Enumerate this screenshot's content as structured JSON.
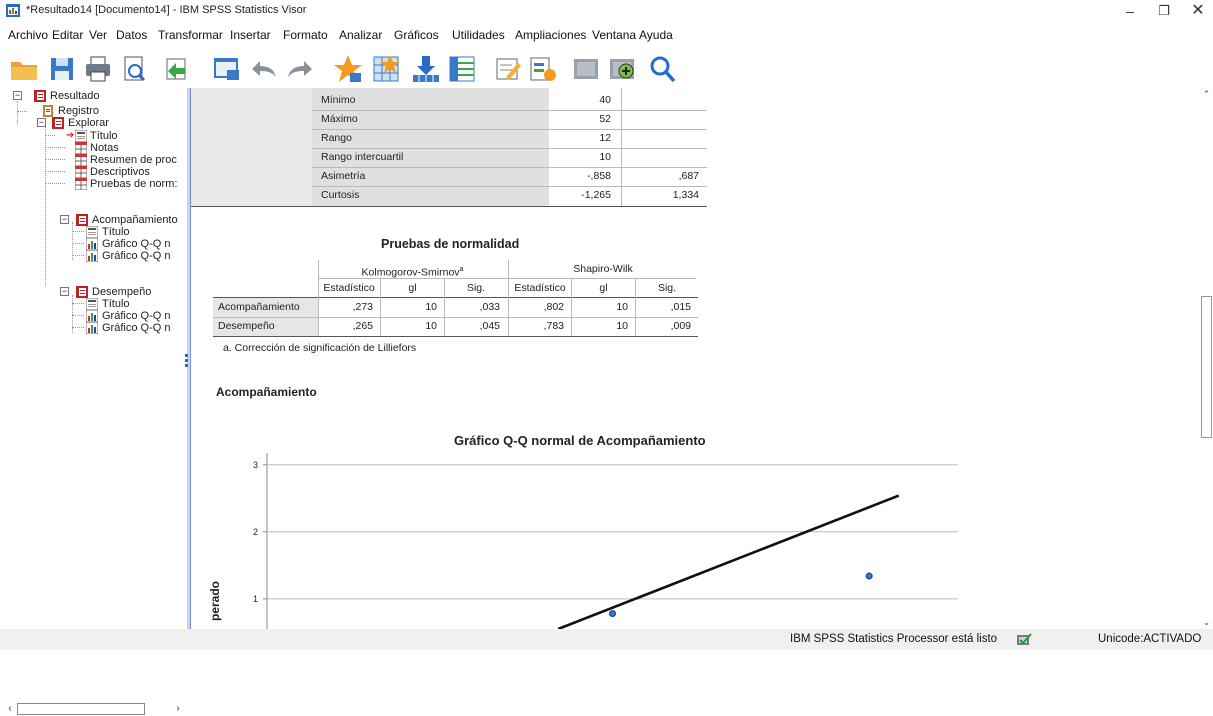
{
  "window": {
    "title": "*Resultado14 [Documento14] - IBM SPSS Statistics Visor",
    "minimize": "–",
    "maximize": "❐",
    "close": "✕"
  },
  "menu": [
    "Archivo",
    "Editar",
    "Ver",
    "Datos",
    "Transformar",
    "Insertar",
    "Formato",
    "Analizar",
    "Gráficos",
    "Utilidades",
    "Ampliaciones",
    "Ventana",
    "Ayuda"
  ],
  "toolbar": {
    "icons": [
      "open-folder-icon",
      "save-icon",
      "print-icon",
      "print-preview-icon",
      "export-icon",
      "recall-dialog-icon",
      "undo-icon",
      "redo-icon",
      "goto-data-icon",
      "goto-case-icon",
      "goto-variable-icon",
      "variables-icon",
      "designate-window-icon",
      "create-script-icon",
      "hide-icon",
      "show-icon",
      "search-icon"
    ]
  },
  "outline": {
    "items": [
      {
        "label": "Resultado",
        "icon": "output-book-icon"
      },
      {
        "label": "Registro",
        "icon": "log-icon"
      },
      {
        "label": "Explorar",
        "icon": "output-book-icon"
      },
      {
        "label": "Título",
        "icon": "title-icon"
      },
      {
        "label": "Notas",
        "icon": "notes-icon"
      },
      {
        "label": "Resumen de proc",
        "icon": "table-icon"
      },
      {
        "label": "Descriptivos",
        "icon": "table-icon"
      },
      {
        "label": "Pruebas de norm:",
        "icon": "table-icon"
      },
      {
        "label": "Acompañamiento",
        "icon": "output-book-icon"
      },
      {
        "label": "Título",
        "icon": "title-icon"
      },
      {
        "label": "Gráfico Q-Q n",
        "icon": "chart-icon"
      },
      {
        "label": "Gráfico Q-Q n",
        "icon": "chart-icon"
      },
      {
        "label": "Desempeño",
        "icon": "output-book-icon"
      },
      {
        "label": "Título",
        "icon": "title-icon"
      },
      {
        "label": "Gráfico Q-Q n",
        "icon": "chart-icon"
      },
      {
        "label": "Gráfico Q-Q n",
        "icon": "chart-icon"
      }
    ]
  },
  "descriptives": {
    "rows": [
      {
        "label": "Mínimo",
        "stat": "40",
        "err": ""
      },
      {
        "label": "Máximo",
        "stat": "52",
        "err": ""
      },
      {
        "label": "Rango",
        "stat": "12",
        "err": ""
      },
      {
        "label": "Rango intercuartil",
        "stat": "10",
        "err": ""
      },
      {
        "label": "Asimetría",
        "stat": "-,858",
        "err": ",687"
      },
      {
        "label": "Curtosis",
        "stat": "-1,265",
        "err": "1,334"
      }
    ]
  },
  "normality": {
    "title": "Pruebas de normalidad",
    "group1": "Kolmogorov-Smirnov",
    "group1_sup": "a",
    "group2": "Shapiro-Wilk",
    "columns": [
      "Estadístico",
      "gl",
      "Sig.",
      "Estadístico",
      "gl",
      "Sig."
    ],
    "rows": [
      {
        "label": "Acompañamiento",
        "values": [
          ",273",
          "10",
          ",033",
          ",802",
          "10",
          ",015"
        ]
      },
      {
        "label": "Desempeño",
        "values": [
          ",265",
          "10",
          ",045",
          ",783",
          "10",
          ",009"
        ]
      }
    ],
    "footnote": "a. Corrección de significación de Lilliefors"
  },
  "section_heading": "Acompañamiento",
  "chart_data": {
    "type": "scatter",
    "title": "Gráfico Q-Q normal de Acompañamiento",
    "ylabel": "Normal esperado",
    "ylabel_visible": "perado",
    "yticks": [
      1,
      2,
      3
    ],
    "ylim": [
      0.55,
      3.25
    ],
    "xlim": [
      39,
      53
    ],
    "points": [
      {
        "x": 46,
        "y": 0.78
      },
      {
        "x": 51.2,
        "y": 1.34
      }
    ],
    "line": {
      "x1": 44.9,
      "y1": 0.55,
      "x2": 51.8,
      "y2": 2.54
    }
  },
  "status": {
    "processor": "IBM SPSS Statistics Processor está listo",
    "unicode": "Unicode:ACTIVADO"
  }
}
